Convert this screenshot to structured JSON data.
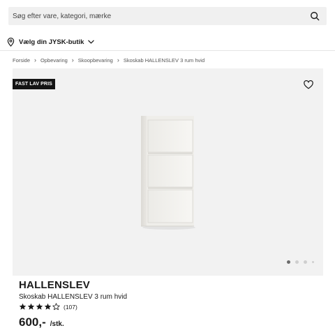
{
  "search": {
    "placeholder": "Søg efter vare, kategori, mærke"
  },
  "store": {
    "label": "Vælg din JYSK-butik"
  },
  "breadcrumb": [
    "Forside",
    "Opbevaring",
    "Skoopbevaring",
    "Skoskab HALLENSLEV 3 rum hvid"
  ],
  "gallery": {
    "badge": "FAST LAV PRIS",
    "image_count": 4,
    "active_index": 0,
    "background": "#f2f2f2"
  },
  "product": {
    "title": "HALLENSLEV",
    "subtitle": "Skoskab HALLENSLEV 3 rum hvid",
    "rating": 4,
    "rating_max": 5,
    "review_count": "(107)",
    "price": "600,-",
    "unit": "/stk."
  },
  "colors": {
    "badge_bg": "#141414",
    "text": "#1a1a1a",
    "search_bg": "#f0f0f0"
  },
  "icons": [
    "search-icon",
    "location-pin-icon",
    "chevron-down-icon",
    "heart-icon",
    "star-icon"
  ]
}
